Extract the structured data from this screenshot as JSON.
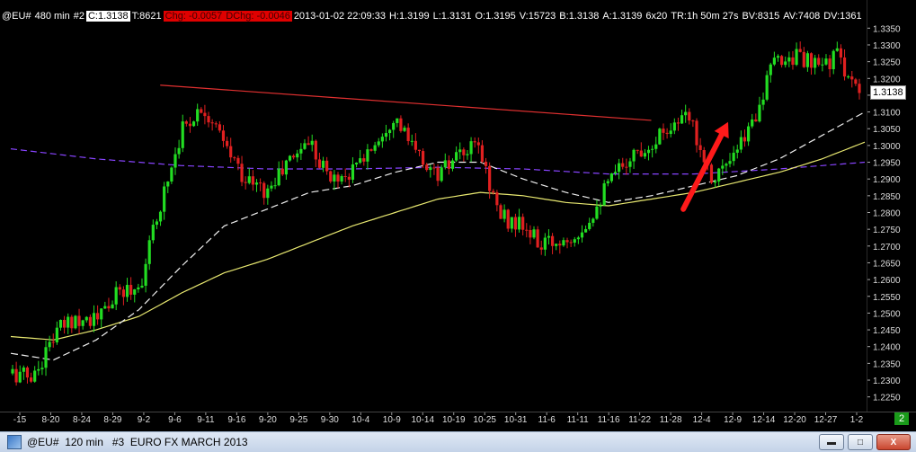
{
  "info_bar": {
    "symbol": "@EU#",
    "interval": "480 min",
    "chart_num": "#2",
    "close": "C:1.3138",
    "tick": "T:8621",
    "chg": "Chg: -0.0057",
    "dchg": "DChg: -0.0046",
    "datetime": "2013-01-02 22:09:33",
    "high": "H:1.3199",
    "low": "L:1.3131",
    "open": "O:1.3195",
    "volume": "V:15723",
    "bid": "B:1.3138",
    "ask": "A:1.3139",
    "size": "6x20",
    "time_remaining": "TR:1h 50m 27s",
    "bid_vol": "BV:8315",
    "ask_vol": "AV:7408",
    "dv": "DV:1361"
  },
  "current_price_label": "1.3138",
  "page_badge": "2",
  "window_title": "@EU#  120 min   #3  EURO FX MARCH 2013",
  "window_buttons": {
    "minimize": "▬",
    "maximize": "□",
    "close": "X"
  },
  "colors": {
    "up": "#22dd22",
    "down": "#e02020",
    "sma_slow": "#e8e870",
    "sma_fast": "#f0f0f0",
    "sma_long": "#8844ff",
    "trendline": "#e03030",
    "arrow": "#ff1a1a"
  },
  "chart_data": {
    "type": "candlestick",
    "price_axis": {
      "ylim": [
        1.2225,
        1.3375
      ],
      "ticks": [
        "1.3350",
        "1.3300",
        "1.3250",
        "1.3200",
        "1.3150",
        "1.3100",
        "1.3050",
        "1.3000",
        "1.2950",
        "1.2900",
        "1.2850",
        "1.2800",
        "1.2750",
        "1.2700",
        "1.2650",
        "1.2600",
        "1.2550",
        "1.2500",
        "1.2450",
        "1.2400",
        "1.2350",
        "1.2300",
        "1.2250"
      ]
    },
    "date_axis": [
      "-15",
      "8-20",
      "8-24",
      "8-29",
      "9-2",
      "9-6",
      "9-11",
      "9-16",
      "9-20",
      "9-25",
      "9-30",
      "10-4",
      "10-9",
      "10-14",
      "10-19",
      "10-25",
      "10-31",
      "11-6",
      "11-11",
      "11-16",
      "11-22",
      "11-28",
      "12-4",
      "12-9",
      "12-14",
      "12-20",
      "12-27",
      "1-2"
    ],
    "trend_path": [
      [
        0,
        1.232
      ],
      [
        1,
        1.231
      ],
      [
        2,
        1.244
      ],
      [
        3,
        1.249
      ],
      [
        4,
        1.248
      ],
      [
        5,
        1.256
      ],
      [
        6,
        1.258
      ],
      [
        7,
        1.283
      ],
      [
        8,
        1.305
      ],
      [
        9,
        1.312
      ],
      [
        10,
        1.3
      ],
      [
        11,
        1.29
      ],
      [
        12,
        1.286
      ],
      [
        13,
        1.295
      ],
      [
        14,
        1.302
      ],
      [
        15,
        1.29
      ],
      [
        16,
        1.292
      ],
      [
        17,
        1.3
      ],
      [
        18,
        1.309
      ],
      [
        19,
        1.298
      ],
      [
        20,
        1.291
      ],
      [
        21,
        1.296
      ],
      [
        22,
        1.3
      ],
      [
        23,
        1.279
      ],
      [
        24,
        1.276
      ],
      [
        25,
        1.27
      ],
      [
        26,
        1.272
      ],
      [
        27,
        1.276
      ],
      [
        28,
        1.287
      ],
      [
        29,
        1.296
      ],
      [
        30,
        1.3
      ],
      [
        31,
        1.306
      ],
      [
        32,
        1.308
      ],
      [
        33,
        1.291
      ],
      [
        34,
        1.295
      ],
      [
        35,
        1.308
      ],
      [
        36,
        1.325
      ],
      [
        37,
        1.327
      ],
      [
        38,
        1.323
      ],
      [
        39,
        1.327
      ],
      [
        40,
        1.314
      ]
    ],
    "sma_fast": [
      [
        0,
        1.238
      ],
      [
        2,
        1.236
      ],
      [
        4,
        1.242
      ],
      [
        6,
        1.251
      ],
      [
        8,
        1.264
      ],
      [
        10,
        1.276
      ],
      [
        12,
        1.281
      ],
      [
        14,
        1.286
      ],
      [
        16,
        1.288
      ],
      [
        18,
        1.292
      ],
      [
        20,
        1.295
      ],
      [
        22,
        1.295
      ],
      [
        24,
        1.29
      ],
      [
        26,
        1.286
      ],
      [
        28,
        1.283
      ],
      [
        30,
        1.285
      ],
      [
        32,
        1.288
      ],
      [
        34,
        1.291
      ],
      [
        36,
        1.296
      ],
      [
        38,
        1.303
      ],
      [
        40,
        1.31
      ]
    ],
    "sma_slow": [
      [
        0,
        1.243
      ],
      [
        2,
        1.242
      ],
      [
        4,
        1.245
      ],
      [
        6,
        1.249
      ],
      [
        8,
        1.256
      ],
      [
        10,
        1.262
      ],
      [
        12,
        1.266
      ],
      [
        14,
        1.271
      ],
      [
        16,
        1.276
      ],
      [
        18,
        1.28
      ],
      [
        20,
        1.284
      ],
      [
        22,
        1.286
      ],
      [
        24,
        1.285
      ],
      [
        26,
        1.283
      ],
      [
        28,
        1.282
      ],
      [
        30,
        1.284
      ],
      [
        32,
        1.286
      ],
      [
        34,
        1.289
      ],
      [
        36,
        1.292
      ],
      [
        38,
        1.296
      ],
      [
        40,
        1.301
      ]
    ],
    "sma_long": [
      [
        0,
        1.299
      ],
      [
        4,
        1.296
      ],
      [
        8,
        1.294
      ],
      [
        12,
        1.293
      ],
      [
        16,
        1.293
      ],
      [
        20,
        1.2935
      ],
      [
        24,
        1.293
      ],
      [
        28,
        1.2915
      ],
      [
        32,
        1.2915
      ],
      [
        36,
        1.293
      ],
      [
        40,
        1.295
      ]
    ],
    "trendline": [
      [
        7,
        1.318
      ],
      [
        30,
        1.3075
      ]
    ],
    "arrow": {
      "from": [
        31.5,
        1.281
      ],
      "to": [
        33.6,
        1.307
      ]
    }
  }
}
